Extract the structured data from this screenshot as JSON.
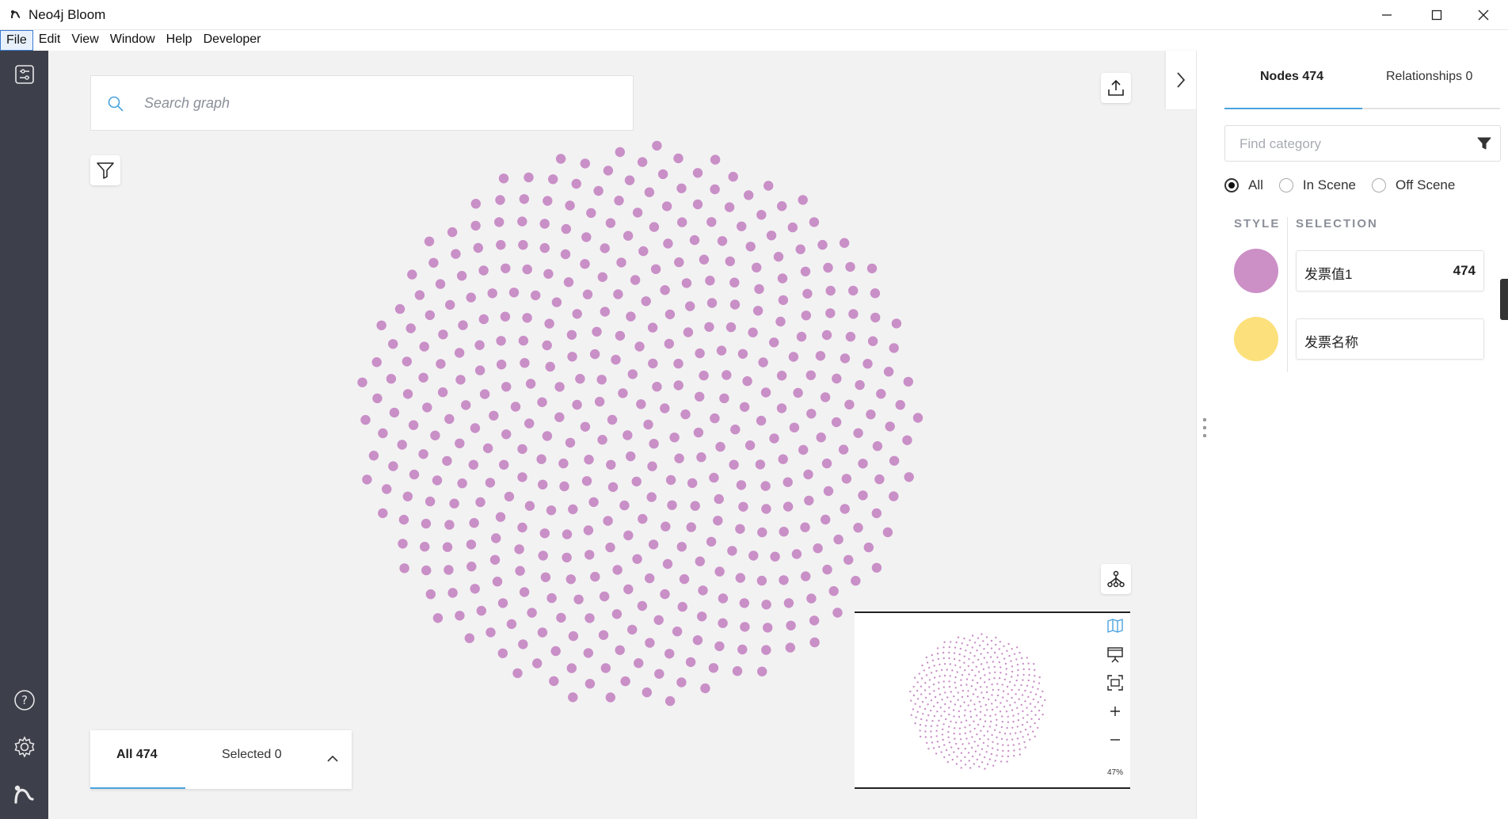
{
  "window": {
    "title": "Neo4j Bloom"
  },
  "menu": {
    "items": [
      "File",
      "Edit",
      "View",
      "Window",
      "Help",
      "Developer"
    ],
    "active": "File"
  },
  "search": {
    "placeholder": "Search graph"
  },
  "bottom_panel": {
    "tab_all": "All 474",
    "tab_selected": "Selected 0"
  },
  "minimap": {
    "zoom_label": "47%"
  },
  "right_panel": {
    "tab_nodes": "Nodes 474",
    "tab_relationships": "Relationships 0",
    "find_placeholder": "Find category",
    "radio": {
      "all": "All",
      "in_scene": "In Scene",
      "off_scene": "Off Scene",
      "selected": "all"
    },
    "header_style": "STYLE",
    "header_selection": "SELECTION",
    "categories": [
      {
        "label": "发票值1",
        "count": "474",
        "color": "#cc8fc6"
      },
      {
        "label": "发票名称",
        "count": "",
        "color": "#fce07b"
      }
    ]
  },
  "graph": {
    "node_count": 474,
    "node_color": "#c98fc7"
  },
  "colors": {
    "sidebar": "#3d3f4a",
    "accent": "#4aa3df",
    "canvas": "#f2f2f2"
  },
  "icons": [
    "neo4j-app-icon",
    "minimize-icon",
    "maximize-icon",
    "close-icon",
    "settings-panel-icon",
    "help-icon",
    "gear-icon",
    "neo4j-logo-icon",
    "search-icon",
    "filter-icon",
    "export-icon",
    "layout-icon",
    "map-icon",
    "presentation-icon",
    "fit-icon",
    "zoom-in-icon",
    "zoom-out-icon",
    "chevron-up-icon",
    "chevron-right-icon",
    "funnel-icon"
  ]
}
